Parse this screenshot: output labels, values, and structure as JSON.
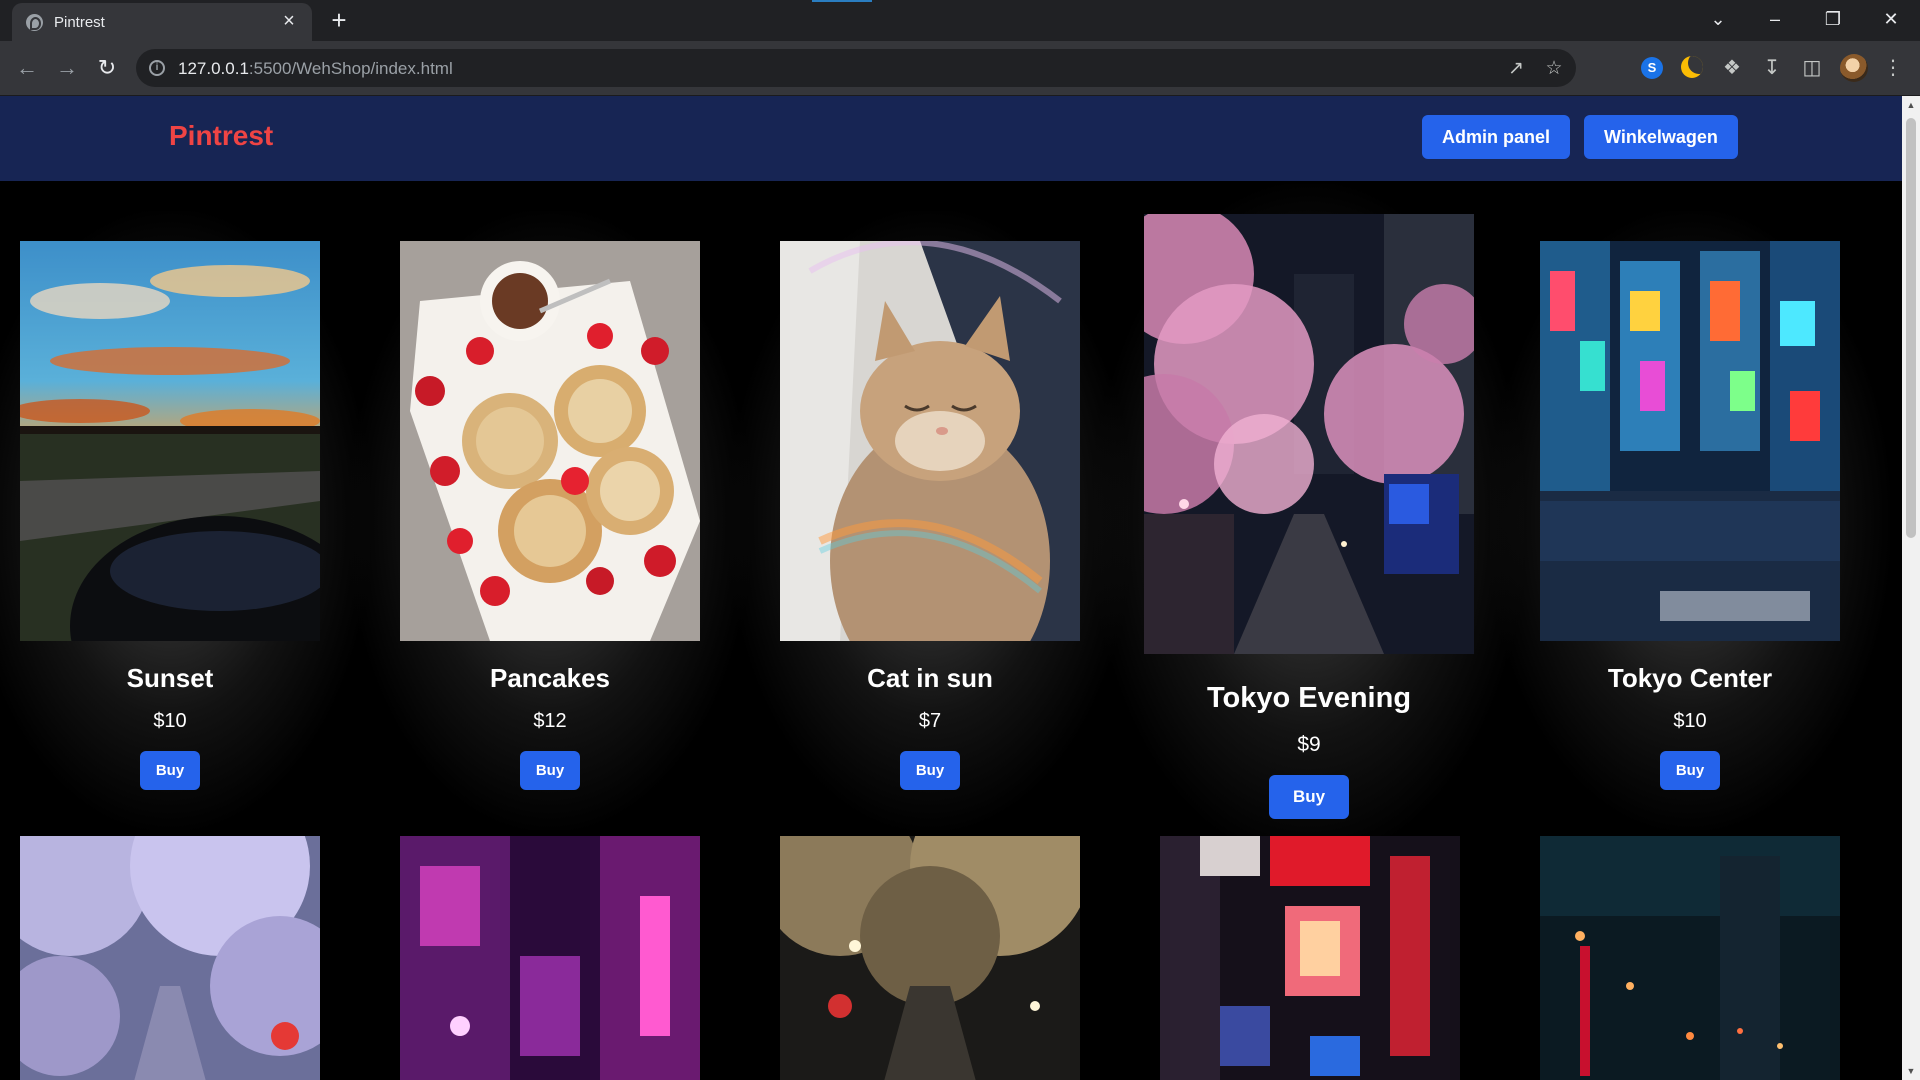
{
  "browser": {
    "tab_title": "Pintrest",
    "url_host": "127.0.0.1",
    "url_rest": ":5500/WehShop/index.html",
    "tab_close_glyph": "×",
    "new_tab_glyph": "+"
  },
  "header": {
    "brand": "Pintrest",
    "admin_label": "Admin panel",
    "cart_label": "Winkelwagen",
    "brand_color": "#ef4444",
    "button_color": "#2563eb",
    "background": "#172554"
  },
  "products": [
    {
      "title": "Sunset",
      "price": "$10",
      "buy": "Buy"
    },
    {
      "title": "Pancakes",
      "price": "$12",
      "buy": "Buy"
    },
    {
      "title": "Cat in sun",
      "price": "$7",
      "buy": "Buy"
    },
    {
      "title": "Tokyo Evening",
      "price": "$9",
      "buy": "Buy"
    },
    {
      "title": "Tokyo Center",
      "price": "$10",
      "buy": "Buy"
    }
  ],
  "icons": [
    "back-icon",
    "forward-icon",
    "reload-icon",
    "info-icon",
    "share-icon",
    "star-icon",
    "extension-icon",
    "moon-icon",
    "puzzle-icon",
    "download-icon",
    "sidebar-icon",
    "avatar",
    "menu-icon"
  ]
}
